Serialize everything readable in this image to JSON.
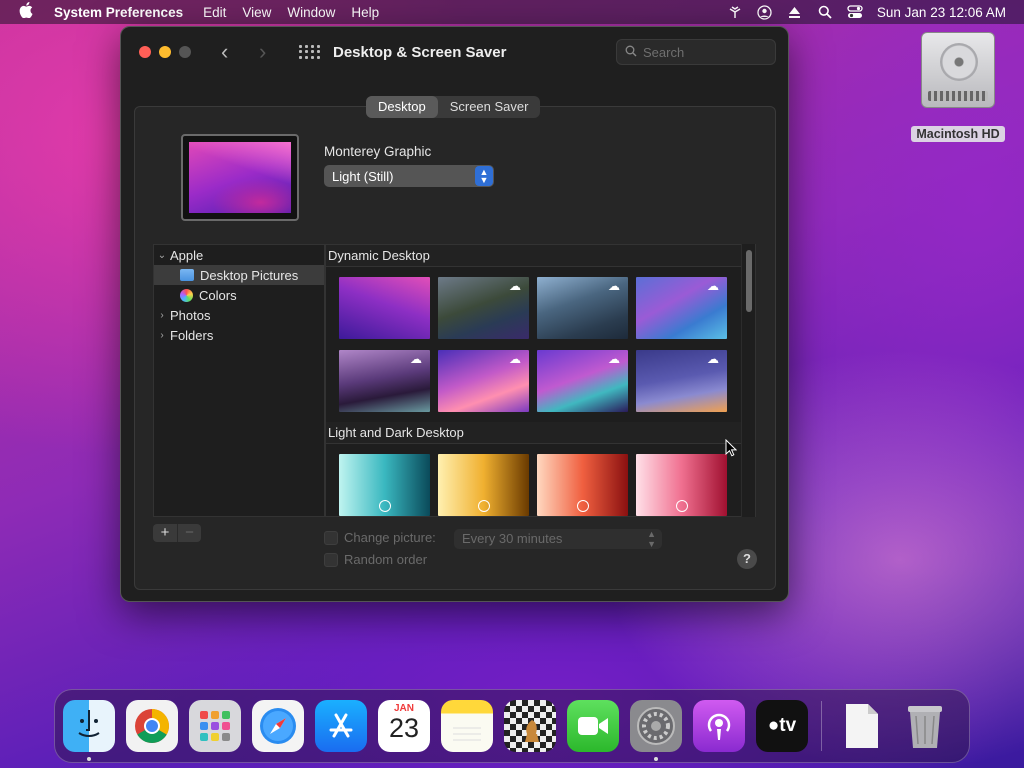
{
  "menubar": {
    "apple": "",
    "app_name": "System Preferences",
    "items": [
      "Edit",
      "View",
      "Window",
      "Help"
    ],
    "datetime": "Sun Jan 23  12:06 AM"
  },
  "desktop": {
    "hd_label": "Macintosh HD"
  },
  "window": {
    "title": "Desktop & Screen Saver",
    "search_placeholder": "Search",
    "tabs": [
      "Desktop",
      "Screen Saver"
    ],
    "active_tab": "Desktop",
    "wallpaper_name": "Monterey Graphic",
    "appearance_value": "Light (Still)",
    "source_list": {
      "apple": "Apple",
      "desktop_pictures": "Desktop Pictures",
      "colors": "Colors",
      "photos": "Photos",
      "folders": "Folders"
    },
    "sections": {
      "dynamic": "Dynamic Desktop",
      "light_dark": "Light and Dark Desktop"
    },
    "options": {
      "change_picture": "Change picture:",
      "interval": "Every 30 minutes",
      "random_order": "Random order"
    },
    "add": "+",
    "remove": "−",
    "help": "?"
  },
  "dock": {
    "calendar_month": "JAN",
    "calendar_day": "23",
    "items": [
      "finder",
      "chrome",
      "launchpad",
      "safari",
      "app-store",
      "calendar",
      "notes",
      "chess",
      "facetime",
      "system-preferences",
      "podcasts",
      "apple-tv",
      "document",
      "trash"
    ]
  }
}
